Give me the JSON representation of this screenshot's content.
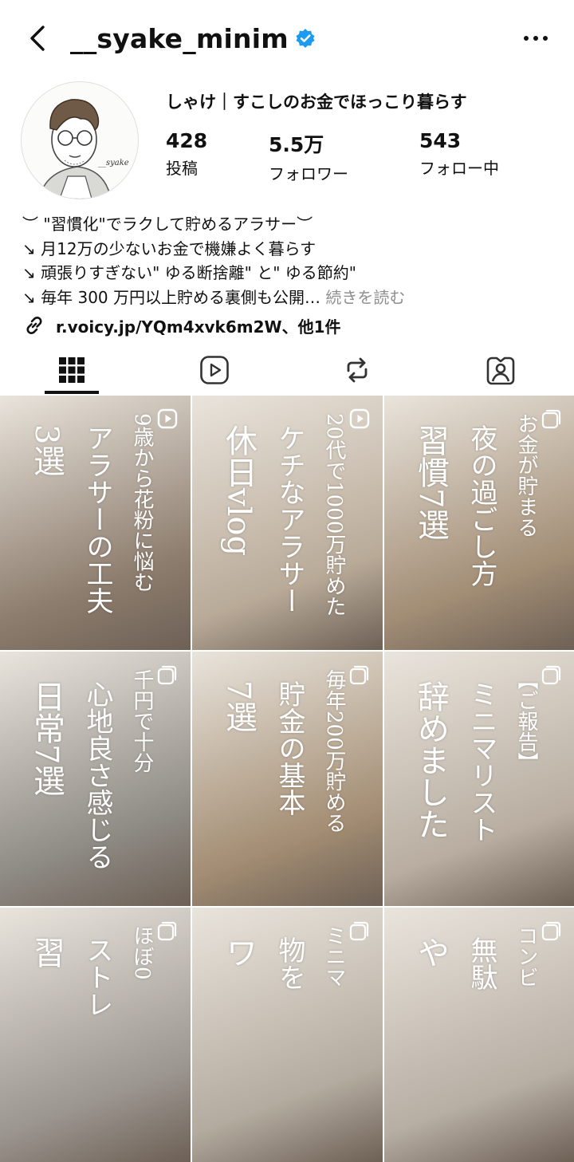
{
  "header": {
    "username": "__syake_minim"
  },
  "profile": {
    "display_name": "しゃけ｜すこしのお金でほっこり暮らす",
    "stats": [
      {
        "value": "428",
        "label": "投稿"
      },
      {
        "value": "5.5万",
        "label": "フォロワー"
      },
      {
        "value": "543",
        "label": "フォロー中"
      }
    ],
    "bio": [
      "︶ \"習慣化\"でラクして貯めるアラサー︶",
      "↘ 月12万の少ないお金で機嫌よく暮らす",
      "↘ 頑張りすぎない\" ゆる断捨離\" と\" ゆる節約\"",
      "↘ 毎年 300 万円以上貯める裏側も公開…"
    ],
    "bio_more": "続きを読む",
    "link": "r.voicy.jp/YQm4xvk6m2W、他1件",
    "avatar_signature": "__syake"
  },
  "tabs": [
    "grid",
    "reels",
    "reposts",
    "tagged"
  ],
  "posts": [
    {
      "lines": [
        "9歳から花粉に悩む",
        "アラサーの工夫",
        "3選"
      ],
      "type": "reel",
      "tone": "#8d7d6e"
    },
    {
      "lines": [
        "20代で1000万貯めた",
        "ケチなアラサー",
        "休日vlog"
      ],
      "type": "reel",
      "tone": "#b9aa98"
    },
    {
      "lines": [
        "お金が貯まる",
        "夜の過ごし方",
        "習慣7選"
      ],
      "type": "carousel",
      "tone": "#a28d75"
    },
    {
      "lines": [
        "千円で十分",
        "心地良さ感じる",
        "日常7選"
      ],
      "type": "carousel",
      "tone": "#8e8a84"
    },
    {
      "lines": [
        "毎年200万貯める",
        "貯金の基本",
        "7選"
      ],
      "type": "carousel",
      "tone": "#a38d73"
    },
    {
      "lines": [
        "【ご報告】",
        "ミニマリスト",
        "辞めました"
      ],
      "type": "carousel",
      "tone": "#b8ada0"
    },
    {
      "lines": [
        "ほぼ0",
        "ストレ",
        "習"
      ],
      "type": "carousel",
      "tone": "#9c9690"
    },
    {
      "lines": [
        "ミニマ",
        "物を",
        "ワ"
      ],
      "type": "carousel",
      "tone": "#b4ab9f"
    },
    {
      "lines": [
        "コンビ",
        "無駄",
        "や"
      ],
      "type": "carousel",
      "tone": "#b7aea4"
    }
  ]
}
